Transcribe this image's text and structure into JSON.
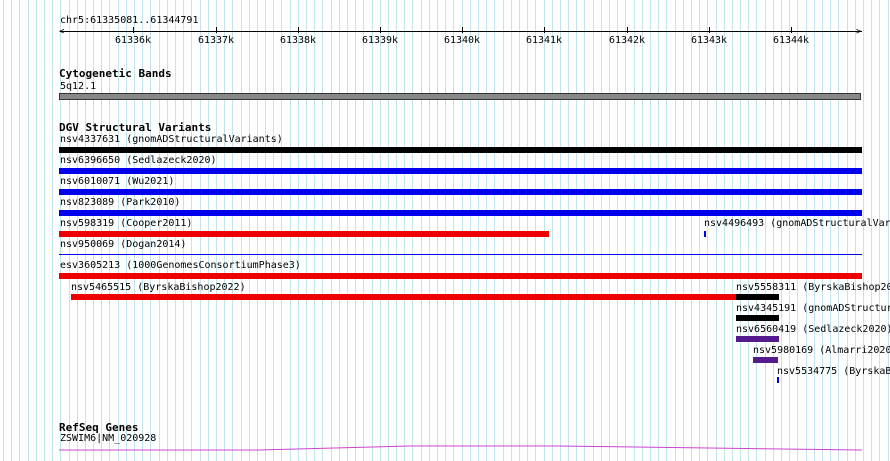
{
  "header": {
    "locus": "chr5:61335081..61344791",
    "ruler_ticks": [
      "61336k",
      "61337k",
      "61338k",
      "61339k",
      "61340k",
      "61341k",
      "61342k",
      "61343k",
      "61344k"
    ]
  },
  "tracks": {
    "cytoband": {
      "title": "Cytogenetic Bands",
      "label": "5q12.1"
    },
    "dgv": {
      "title": "DGV Structural Variants",
      "features": [
        {
          "label": "nsv4337631 (gnomADStructuralVariants)",
          "color": "#000000"
        },
        {
          "label": "nsv6396650 (Sedlazeck2020)",
          "color": "#0000ee"
        },
        {
          "label": "nsv6010071 (Wu2021)",
          "color": "#0000ee"
        },
        {
          "label": "nsv823089 (Park2010)",
          "color": "#0000ee"
        },
        {
          "label": "nsv598319 (Cooper2011)",
          "color": "#ee0000"
        },
        {
          "label": "nsv4496493 (gnomADStructuralVar",
          "color": "#0000ee"
        },
        {
          "label": "nsv950069 (Dogan2014)",
          "color": "#0000ee"
        },
        {
          "label": "esv3605213 (1000GenomesConsortiumPhase3)",
          "color": "#ee0000"
        },
        {
          "label": "nsv5465515 (ByrskaBishop2022)",
          "color": "#ee0000"
        },
        {
          "label": "nsv5558311 (ByrskaBishop20",
          "color": "#000000"
        },
        {
          "label": "nsv4345191 (gnomADStructur",
          "color": "#000000"
        },
        {
          "label": "nsv6560419 (Sedlazeck2020)",
          "color": "#551a8b"
        },
        {
          "label": "nsv5980169 (Almarri2020",
          "color": "#551a8b"
        },
        {
          "label": "nsv5534775 (ByrskaB",
          "color": "#0000ee"
        }
      ]
    },
    "refseq": {
      "title": "RefSeq Genes",
      "label": "ZSWIM6|NM_020928",
      "color": "#cc44cc"
    }
  }
}
